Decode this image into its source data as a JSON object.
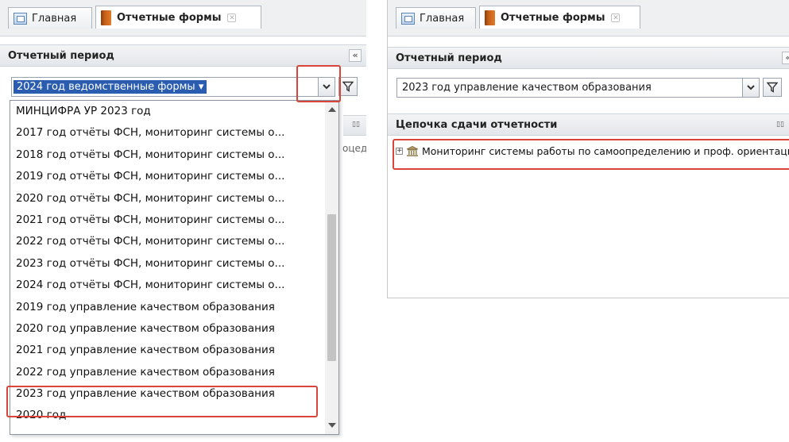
{
  "left": {
    "tabs": {
      "home": "Главная",
      "forms": "Отчетные формы"
    },
    "period_header": "Отчетный период",
    "collapse_glyph": "«",
    "combo_value": "2024 год ведомственные формы ▾",
    "background_text": "оцеду",
    "dropdown_items": [
      "МИНЦИФРА УР 2023 год",
      "2017 год отчёты ФСН, мониторинг системы о...",
      "2018 год отчёты ФСН, мониторинг системы о...",
      "2019 год отчёты ФСН, мониторинг системы о...",
      "2020 год отчёты ФСН, мониторинг системы о...",
      "2021 год отчёты ФСН, мониторинг системы о...",
      "2022 год отчёты ФСН, мониторинг системы о...",
      "2023 год отчёты ФСН, мониторинг системы о...",
      "2024 год отчёты ФСН, мониторинг системы о...",
      "2019 год управление качеством образования",
      "2020 год управление качеством образования",
      "2021 год управление качеством образования",
      "2022 год управление качеством образования",
      "2023 год управление качеством образования",
      "2020 год"
    ]
  },
  "right": {
    "tabs": {
      "home": "Главная",
      "forms": "Отчетные формы"
    },
    "period_header": "Отчетный период",
    "collapse_glyph": "«",
    "combo_value": "2023 год управление качеством образования",
    "chain_header": "Цепочка сдачи отчетности",
    "tree_expander": "+",
    "tree_item": "Мониторинг системы работы по самоопределению и проф. ориентации"
  },
  "colors": {
    "highlight_border": "#d9453a",
    "selection": "#2a5db0"
  }
}
